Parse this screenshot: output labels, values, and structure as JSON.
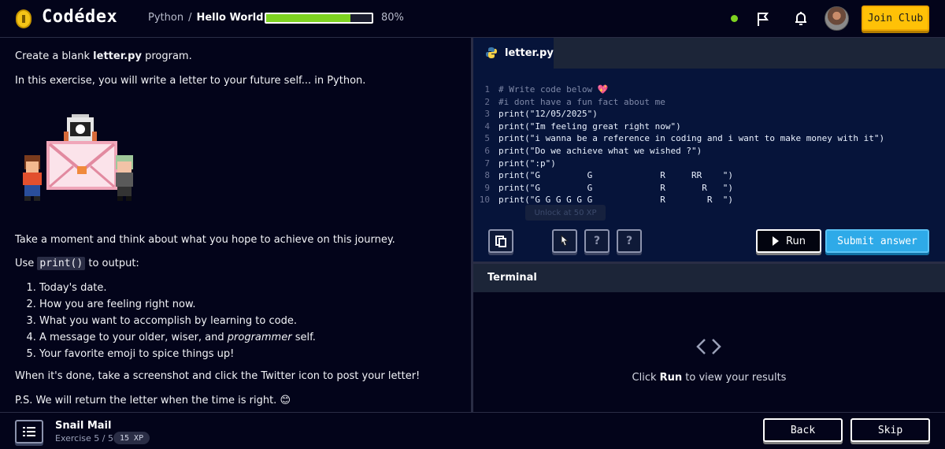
{
  "app": {
    "name": "Codédex"
  },
  "header": {
    "breadcrumb": {
      "course": "Python",
      "separator": "/",
      "lesson": "Hello World"
    },
    "progress_percent": 80,
    "progress_text": "80%",
    "join_label": "Join Club"
  },
  "lesson": {
    "intro_pre": "Create a blank ",
    "intro_file": "letter.py",
    "intro_post": " program.",
    "p1": "In this exercise, you will write a letter to your future self... in Python.",
    "p2": "Take a moment and think about what you hope to achieve on this journey.",
    "use_pre": "Use ",
    "use_code": "print()",
    "use_post": " to output:",
    "list": [
      "Today's date.",
      "How you are feeling right now.",
      "What you want to accomplish by learning to code.",
      "A message to your older, wiser, and ",
      "Your favorite emoji to spice things up!"
    ],
    "list_item4_em": "programmer",
    "list_item4_post": " self.",
    "p3": "When it's done, take a screenshot and click the Twitter icon to post your letter!",
    "p4": "P.S. We will return the letter when the time is right. 😊"
  },
  "editor": {
    "tab_label": "letter.py",
    "lines": [
      "# Write code below 💖",
      "#i dont have a fun fact about me",
      "print(\"12/05/2025\")",
      "print(\"Im feeling great right now\")",
      "print(\"i wanna be a reference in coding and i want to make money with it\")",
      "print(\"Do we achieve what we wished ?\")",
      "print(\":p\")",
      "print(\"G         G             R     RR    \")",
      "print(\"G         G             R       R   \")",
      "print(\"G G G G G G             R        R  \")"
    ],
    "line_numbers": [
      "1",
      "2",
      "3",
      "4",
      "5",
      "6",
      "7",
      "8",
      "9",
      "10"
    ],
    "unlock_tooltip": "Unlock at 50 XP",
    "hint_label": "?",
    "run_label": "Run",
    "submit_label": "Submit answer"
  },
  "terminal": {
    "title": "Terminal",
    "hint_pre": "Click ",
    "hint_bold": "Run",
    "hint_post": " to view your results"
  },
  "footer": {
    "exercise_title": "Snail Mail",
    "exercise_meta": "Exercise 5 / 5",
    "xp": "15 XP",
    "back_label": "Back",
    "skip_label": "Skip"
  },
  "colors": {
    "background": "#03041a",
    "editor_bg": "#06143a",
    "accent_yellow": "#ffc107",
    "accent_blue": "#2eaae8",
    "progress_green": "#7ed321"
  },
  "icons": [
    "coin-logo-icon",
    "flag-icon",
    "bell-icon",
    "python-icon",
    "copy-icon",
    "cursor-icon",
    "help-icon",
    "play-icon",
    "code-brackets-icon",
    "list-icon"
  ]
}
